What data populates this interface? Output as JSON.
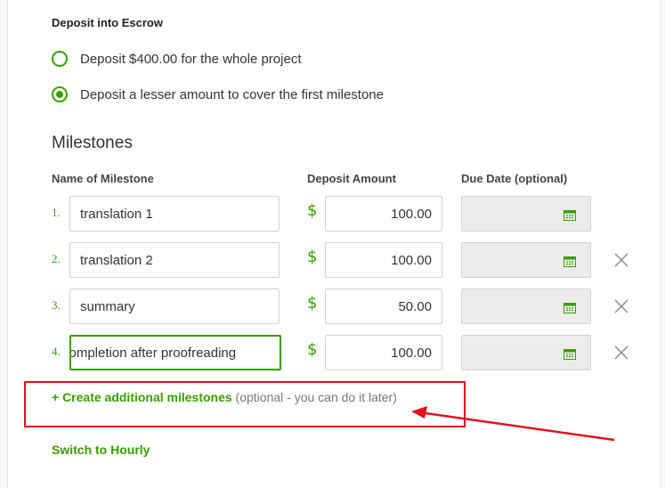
{
  "deposit": {
    "title": "Deposit into Escrow",
    "options": [
      {
        "label": "Deposit $400.00 for the whole project",
        "checked": false
      },
      {
        "label": "Deposit a lesser amount to cover the first milestone",
        "checked": true
      }
    ]
  },
  "milestones": {
    "heading": "Milestones",
    "columns": {
      "name": "Name of Milestone",
      "amount": "Deposit Amount",
      "due": "Due Date (optional)"
    },
    "currency_symbol": "$",
    "rows": [
      {
        "number": "1.",
        "name": "translation 1",
        "amount": "100.00",
        "due": "",
        "removable": false
      },
      {
        "number": "2.",
        "name": "translation 2",
        "amount": "100.00",
        "due": "",
        "removable": true
      },
      {
        "number": "3.",
        "name": "summary",
        "amount": "50.00",
        "due": "",
        "removable": true
      },
      {
        "number": "4.",
        "name": "completion after proofreading",
        "amount": "100.00",
        "due": "",
        "removable": true,
        "focused": true
      }
    ],
    "create_link": "+ Create additional milestones",
    "create_hint": " (optional - you can do it later)"
  },
  "switch_hourly": "Switch to Hourly",
  "colors": {
    "accent": "#37a000",
    "annotation": "#e0141c",
    "date_field_bg": "#ececec"
  },
  "icons": {
    "calendar": "calendar-icon",
    "remove": "close-icon"
  }
}
